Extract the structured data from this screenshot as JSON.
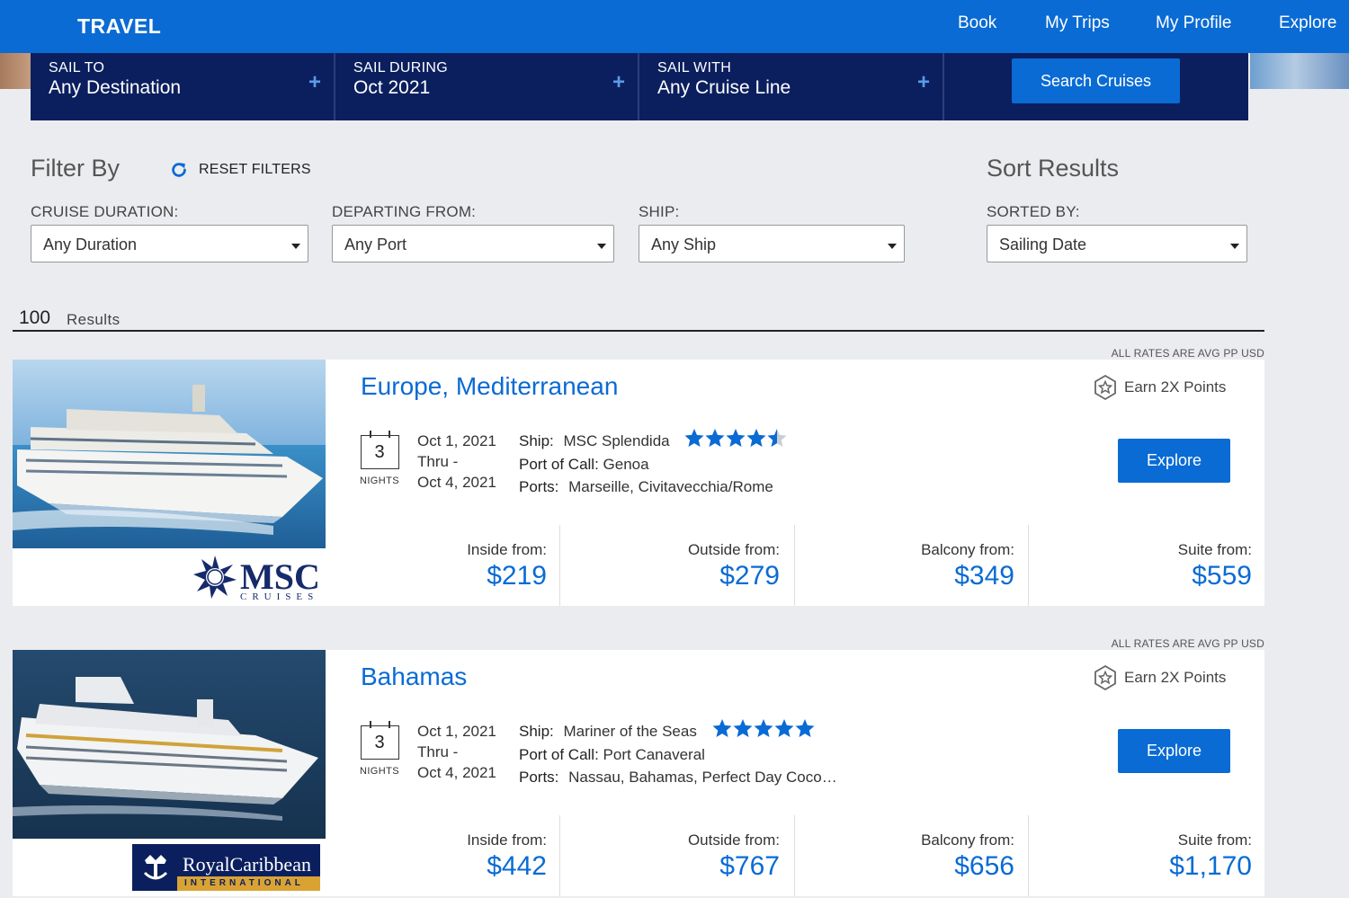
{
  "nav": {
    "brand": "TRAVEL",
    "links": [
      "Book",
      "My Trips",
      "My Profile",
      "Explore"
    ]
  },
  "search": {
    "sail_to": {
      "label": "SAIL TO",
      "value": "Any Destination"
    },
    "sail_during": {
      "label": "SAIL DURING",
      "value": "Oct 2021"
    },
    "sail_with": {
      "label": "SAIL WITH",
      "value": "Any Cruise Line"
    },
    "button": "Search Cruises"
  },
  "filters": {
    "title": "Filter By",
    "reset": "RESET FILTERS",
    "duration": {
      "label": "CRUISE DURATION:",
      "value": "Any Duration"
    },
    "departing": {
      "label": "DEPARTING FROM:",
      "value": "Any Port"
    },
    "ship": {
      "label": "SHIP:",
      "value": "Any Ship"
    }
  },
  "sort": {
    "title": "Sort Results",
    "label": "SORTED BY:",
    "value": "Sailing Date"
  },
  "results": {
    "count": "100",
    "count_label": "Results",
    "rates_note": "ALL RATES ARE AVG PP USD",
    "items": [
      {
        "destination": "Europe, Mediterranean",
        "nights": "3",
        "nights_label": "NIGHTS",
        "date_start": "Oct 1, 2021",
        "thru": "Thru -",
        "date_end": "Oct 4, 2021",
        "ship_label": "Ship:",
        "ship": "MSC Splendida",
        "rating": 4.5,
        "port_label": "Port of Call:",
        "port": "Genoa",
        "ports_label": "Ports:",
        "ports": "Marseille, Civitavecchia/Rome",
        "earn": "Earn 2X Points",
        "explore": "Explore",
        "line_logo": "MSC",
        "line_logo_sub": "CRUISES",
        "prices": [
          {
            "label": "Inside from:",
            "value": "$219"
          },
          {
            "label": "Outside from:",
            "value": "$279"
          },
          {
            "label": "Balcony from:",
            "value": "$349"
          },
          {
            "label": "Suite from:",
            "value": "$559"
          }
        ]
      },
      {
        "destination": "Bahamas",
        "nights": "3",
        "nights_label": "NIGHTS",
        "date_start": "Oct 1, 2021",
        "thru": "Thru -",
        "date_end": "Oct 4, 2021",
        "ship_label": "Ship:",
        "ship": "Mariner of the Seas",
        "rating": 5,
        "port_label": "Port of Call:",
        "port": "Port Canaveral",
        "ports_label": "Ports:",
        "ports": "Nassau, Bahamas, Perfect Day Coco…",
        "earn": "Earn 2X Points",
        "explore": "Explore",
        "line_logo": "RoyalCaribbean",
        "line_logo_sub": "INTERNATIONAL",
        "prices": [
          {
            "label": "Inside from:",
            "value": "$442"
          },
          {
            "label": "Outside from:",
            "value": "$767"
          },
          {
            "label": "Balcony from:",
            "value": "$656"
          },
          {
            "label": "Suite from:",
            "value": "$1,170"
          }
        ]
      }
    ]
  },
  "colors": {
    "accent": "#0a6bd4",
    "navy": "#0b1f5e",
    "background": "#ebecef"
  }
}
